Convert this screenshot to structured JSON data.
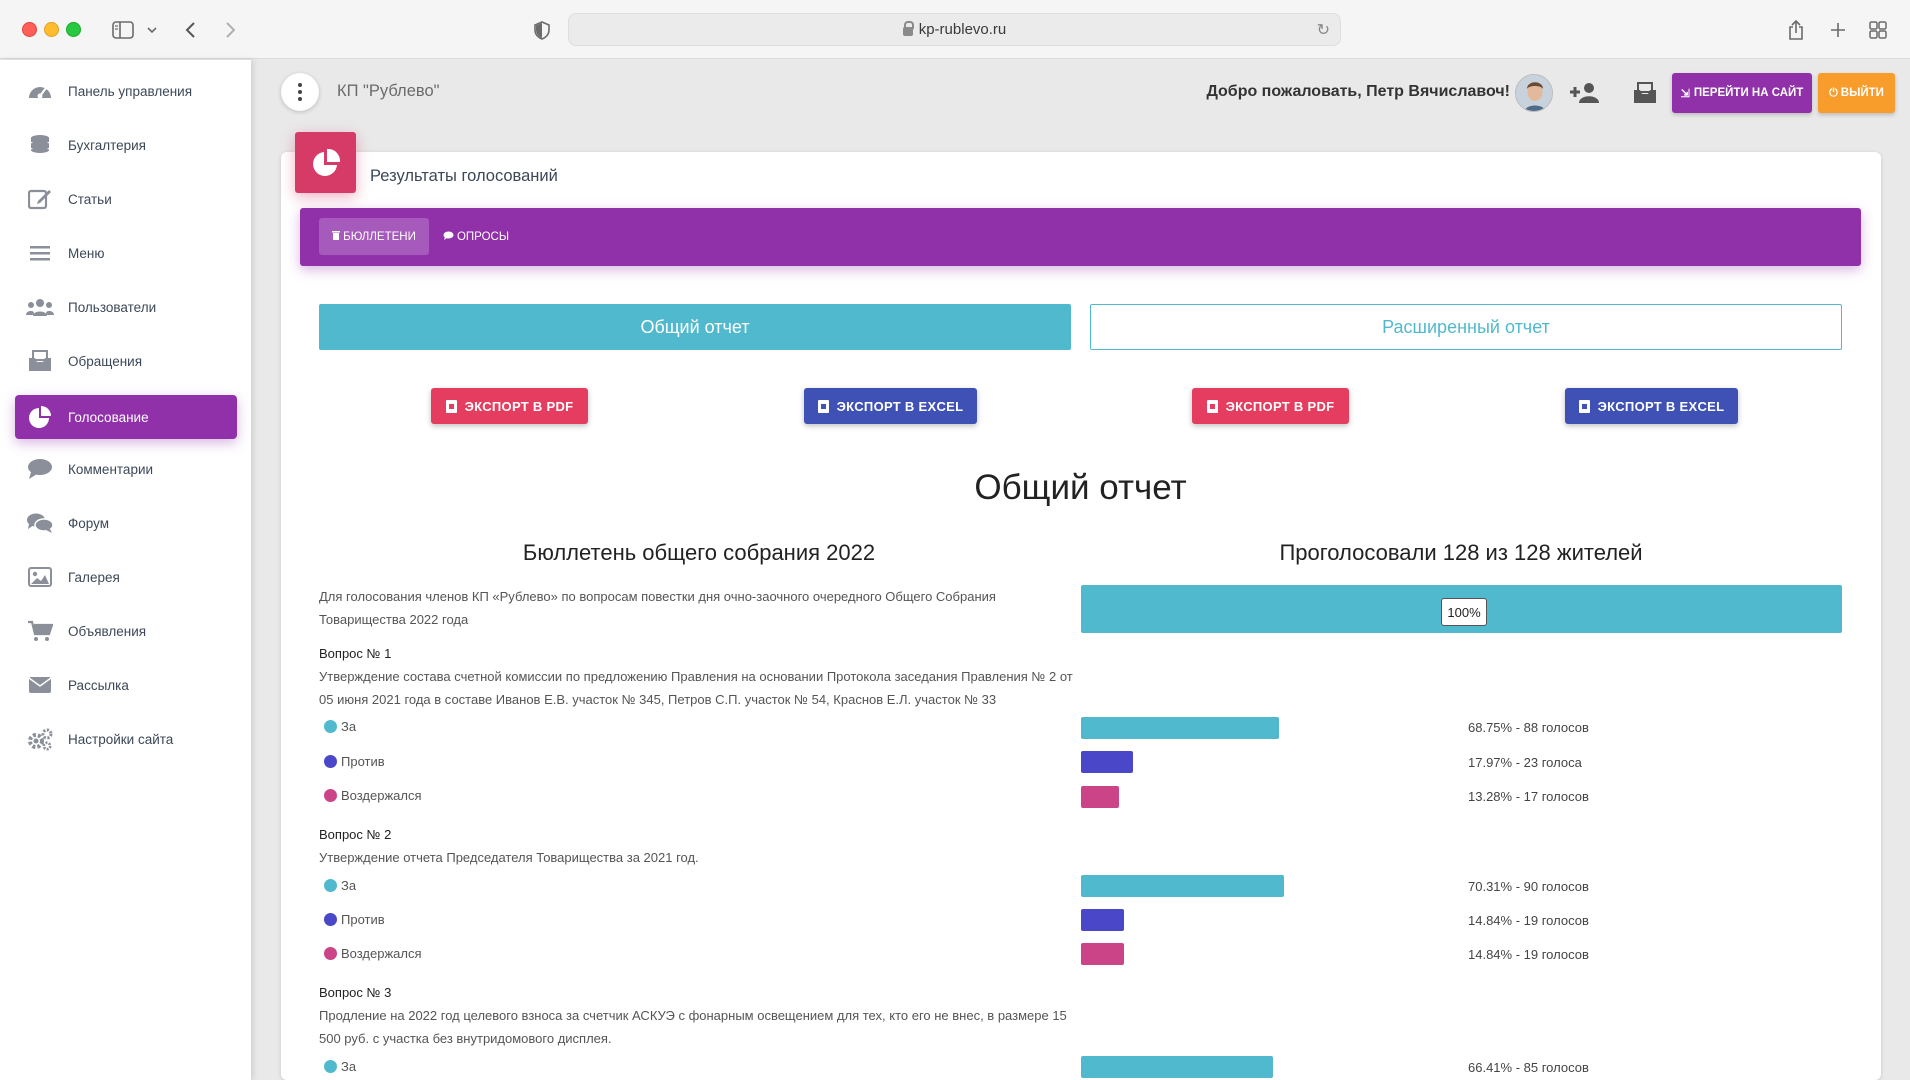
{
  "browser": {
    "url": "kp-rublevo.ru"
  },
  "sidebar": {
    "items": [
      {
        "label": "Панель управления",
        "icon": "dashboard-icon",
        "active": false
      },
      {
        "label": "Бухгалтерия",
        "icon": "coins-icon",
        "active": false
      },
      {
        "label": "Статьи",
        "icon": "edit-icon",
        "active": false
      },
      {
        "label": "Меню",
        "icon": "menu-icon",
        "active": false
      },
      {
        "label": "Пользователи",
        "icon": "users-icon",
        "active": false
      },
      {
        "label": "Обращения",
        "icon": "inbox-icon",
        "active": false
      },
      {
        "label": "Голосование",
        "icon": "pie-chart-icon",
        "active": true
      },
      {
        "label": "Комментарии",
        "icon": "comment-icon",
        "active": false
      },
      {
        "label": "Форум",
        "icon": "comments-icon",
        "active": false
      },
      {
        "label": "Галерея",
        "icon": "image-icon",
        "active": false
      },
      {
        "label": "Объявления",
        "icon": "cart-icon",
        "active": false
      },
      {
        "label": "Рассылка",
        "icon": "envelope-icon",
        "active": false
      },
      {
        "label": "Настройки сайта",
        "icon": "gears-icon",
        "active": false
      }
    ]
  },
  "header": {
    "brand": "КП \"Рублево\"",
    "welcome": "Добро пожаловать, Петр Вячиславоч!",
    "site_button": "Перейти на сайт",
    "exit_button": "Выйти"
  },
  "card": {
    "title": "Результаты голосований",
    "tabs": [
      {
        "label": "Бюллетени",
        "selected": true
      },
      {
        "label": "Опросы",
        "selected": false
      }
    ]
  },
  "reports": {
    "general_label": "Общий отчет",
    "extended_label": "Расширенный отчет",
    "export_pdf": "Экспорт в PDF",
    "export_excel": "Экспорт в Excel"
  },
  "report": {
    "heading": "Общий отчет",
    "bulletin_title": "Бюллетень общего собрания 2022",
    "voted_summary": "Проголосовали 128 из 128 жителей",
    "description": "Для голосования членов КП «Рублево» по вопросам повестки дня очно-заочного очередного Общего Собрания Товарищества 2022 года",
    "turnout_percent": 100,
    "turnout_label": "100%"
  },
  "colors": {
    "accent": "#9031aa",
    "za": "#51b9ce",
    "protiv": "#4a48c8",
    "vozderzhalsya": "#cc4488"
  },
  "questions": [
    {
      "title": "Вопрос № 1",
      "text": "Утверждение состава счетной комиссии по предложению Правления на основании Протокола заседания Правления № 2 от 05 июня 2021 года в составе Иванов Е.В. участок № 345, Петров С.П. участок № 54, Краснов Е.Л. участок № 33",
      "options": [
        {
          "label": "За",
          "percent": 68.75,
          "result": "68.75% - 88 голосов"
        },
        {
          "label": "Против",
          "percent": 17.97,
          "result": "17.97% - 23 голоса"
        },
        {
          "label": "Воздержался",
          "percent": 13.28,
          "result": "13.28% - 17 голосов"
        }
      ]
    },
    {
      "title": "Вопрос № 2",
      "text": "Утверждение отчета Председателя Товарищества за 2021 год.",
      "options": [
        {
          "label": "За",
          "percent": 70.31,
          "result": "70.31% - 90 голосов"
        },
        {
          "label": "Против",
          "percent": 14.84,
          "result": "14.84% - 19 голосов"
        },
        {
          "label": "Воздержался",
          "percent": 14.84,
          "result": "14.84% - 19 голосов"
        }
      ]
    },
    {
      "title": "Вопрос № 3",
      "text": "Продление на 2022 год целевого взноса за счетчик АСКУЭ с фонарным освещением для тех, кто его не внес, в размере 15 500 руб. с участка без внутридомового дисплея.",
      "options": [
        {
          "label": "За",
          "percent": 66.41,
          "result": "66.41% - 85 голосов"
        }
      ]
    }
  ]
}
